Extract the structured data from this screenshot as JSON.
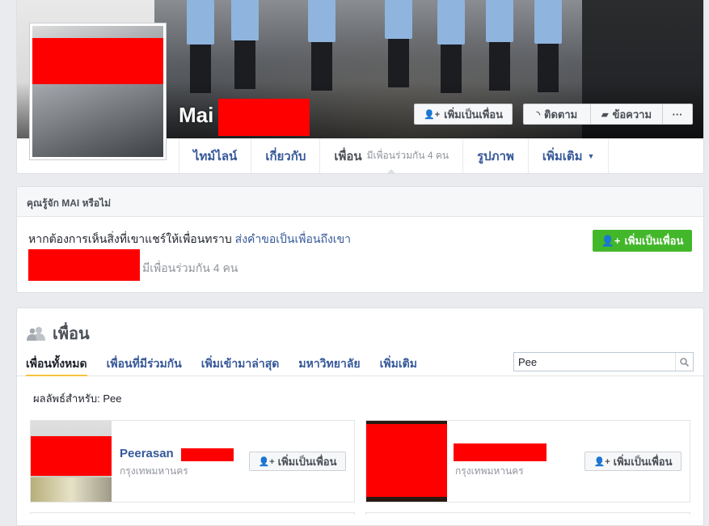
{
  "profile": {
    "name": "Mai",
    "buttons": {
      "add_friend": "เพิ่มเป็นเพื่อน",
      "follow": "ติดตาม",
      "message": "ข้อความ",
      "more": "···"
    }
  },
  "nav": {
    "tabs": [
      {
        "label": "ไทม์ไลน์"
      },
      {
        "label": "เกี่ยวกับ"
      },
      {
        "label": "เพื่อน",
        "sub": "มีเพื่อนร่วมกัน 4 คน"
      },
      {
        "label": "รูปภาพ"
      },
      {
        "label": "เพิ่มเติม"
      }
    ]
  },
  "know": {
    "title": "คุณรู้จัก MAI หรือไม่",
    "text": "หากต้องการเห็นสิ่งที่เขาแชร์ให้เพื่อนทราบ",
    "link": "ส่งคำขอเป็นเพื่อนถึงเขา",
    "mutual": "มีเพื่อนร่วมกัน 4 คน",
    "add_button": "เพิ่มเป็นเพื่อน"
  },
  "friends": {
    "title": "เพื่อน",
    "tabs": [
      "เพื่อนทั้งหมด",
      "เพื่อนที่มีร่วมกัน",
      "เพิ่มเข้ามาล่าสุด",
      "มหาวิทยาลัย",
      "เพิ่มเติม"
    ],
    "search_value": "Pee",
    "results_for": "ผลลัพธ์สำหรับ: Pee",
    "items": [
      {
        "name": "Peerasan",
        "location": "กรุงเทพมหานคร",
        "button": "เพิ่มเป็นเพื่อน"
      },
      {
        "name": "",
        "location": "กรุงเทพมหานคร",
        "button": "เพิ่มเป็นเพื่อน"
      }
    ]
  },
  "colors": {
    "link_blue": "#365899",
    "green_button": "#42b72a",
    "redaction": "#ff0000",
    "active_tab_underline": "#f5c33b"
  }
}
